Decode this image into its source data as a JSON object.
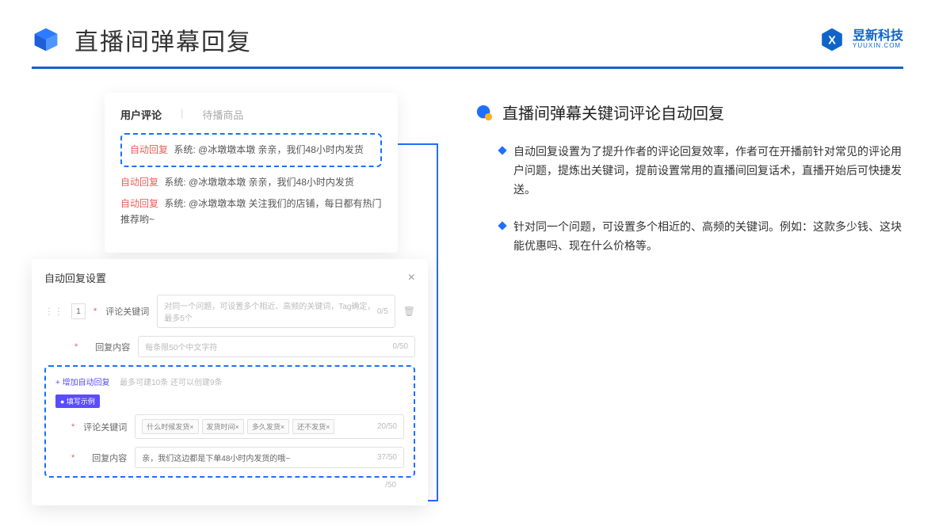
{
  "header": {
    "title": "直播间弹幕回复"
  },
  "logo": {
    "cn": "昱新科技",
    "en": "YUUXIN.COM"
  },
  "panel": {
    "tabs": {
      "active": "用户评论",
      "inactive": "待播商品"
    },
    "highlighted": {
      "tag": "自动回复",
      "text": "系统: @冰墩墩本墩 亲亲，我们48小时内发货"
    },
    "lines": [
      {
        "tag": "自动回复",
        "text": "系统: @冰墩墩本墩 亲亲，我们48小时内发货"
      },
      {
        "tag": "自动回复",
        "text": "系统: @冰墩墩本墩 关注我们的店铺，每日都有热门推荐哟~"
      }
    ]
  },
  "settings": {
    "title": "自动回复设置",
    "idx": "1",
    "keywordLabel": "评论关键词",
    "keywordPlaceholder": "对同一个问题，可设置多个相近、高频的关键词，Tag确定，最多5个",
    "keywordCount": "0/5",
    "contentLabel": "回复内容",
    "contentPlaceholder": "每条限50个中文字符",
    "contentCount": "0/50",
    "addLink": "+ 增加自动回复",
    "addNote": "最多可建10条 还可以创建9条",
    "badge": "● 填写示例",
    "ex": {
      "kwLabel": "评论关键词",
      "tags": [
        "什么时候发货×",
        "发货时间×",
        "多久发货×",
        "还不发货×"
      ],
      "kwCount": "20/50",
      "ctLabel": "回复内容",
      "ctText": "亲，我们这边都是下单48小时内发货的哦~",
      "ctCount": "37/50"
    },
    "extraCount": "/50"
  },
  "right": {
    "title": "直播间弹幕关键词评论自动回复",
    "bullets": [
      "自动回复设置为了提升作者的评论回复效率，作者可在开播前针对常见的评论用户问题，提炼出关键词，提前设置常用的直播间回复话术，直播开始后可快捷发送。",
      "针对同一个问题，可设置多个相近的、高频的关键词。例如：这款多少钱、这块能优惠吗、现在什么价格等。"
    ]
  }
}
